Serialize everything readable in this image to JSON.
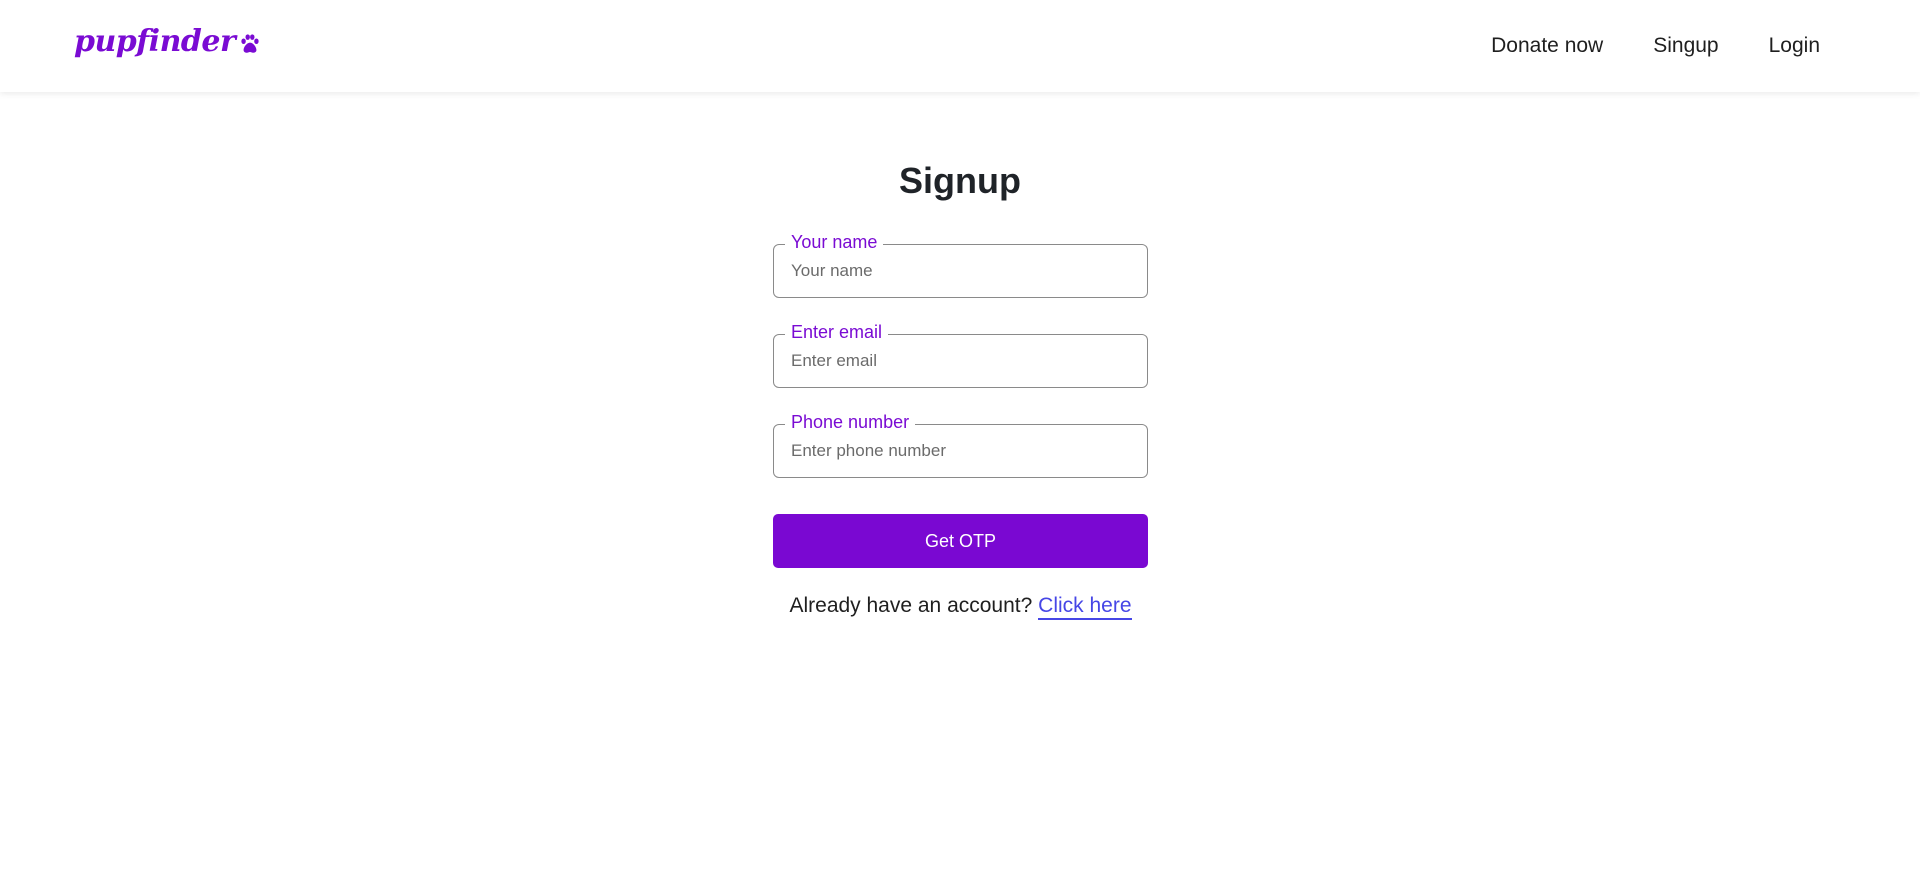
{
  "brand": {
    "name": "pupfinder",
    "icon": "paw-icon",
    "color": "#7a0bd3"
  },
  "nav": {
    "items": [
      {
        "label": "Donate now"
      },
      {
        "label": "Singup"
      },
      {
        "label": "Login"
      }
    ]
  },
  "page": {
    "title": "Signup"
  },
  "form": {
    "fields": [
      {
        "label": "Your name",
        "placeholder": "Your name",
        "value": ""
      },
      {
        "label": "Enter email",
        "placeholder": "Enter email",
        "value": ""
      },
      {
        "label": "Phone number",
        "placeholder": "Enter phone number",
        "value": ""
      }
    ],
    "submit_label": "Get OTP",
    "submit_color": "#7a08d2",
    "account_prompt": "Already have an account?",
    "login_link_label": "Click here",
    "link_color": "#4646e6"
  }
}
